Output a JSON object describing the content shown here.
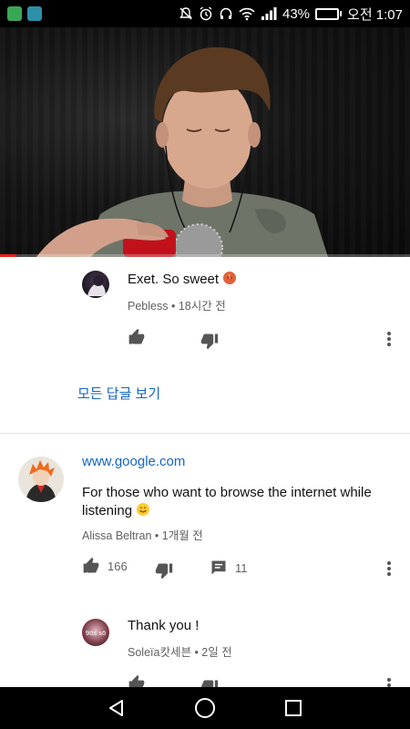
{
  "status_bar": {
    "battery_percent": "43%",
    "time": "오전 1:07",
    "battery_level": 0.43
  },
  "video": {
    "progress_fraction": 0.04
  },
  "comments": {
    "reply_1": {
      "text": "Exet. So sweet",
      "author": "Pebless",
      "age": "18시간 전"
    },
    "view_all_replies": "모든 답글 보기",
    "top_comment": {
      "title_link": "www.google.com",
      "text": "For those who want to browse the internet while listening",
      "author": "Alissa Beltran",
      "age": "1개월 전",
      "like_count": "166",
      "reply_count": "11"
    },
    "reply_2": {
      "text": "Thank you !",
      "author": "Soleïa캇세븐",
      "age": "2일 전",
      "avatar_badge": "9ōs sō"
    }
  },
  "colors": {
    "link": "#1565c0",
    "meta": "#606060",
    "accent_red": "#e62117",
    "battery_green": "#5fd14a"
  }
}
